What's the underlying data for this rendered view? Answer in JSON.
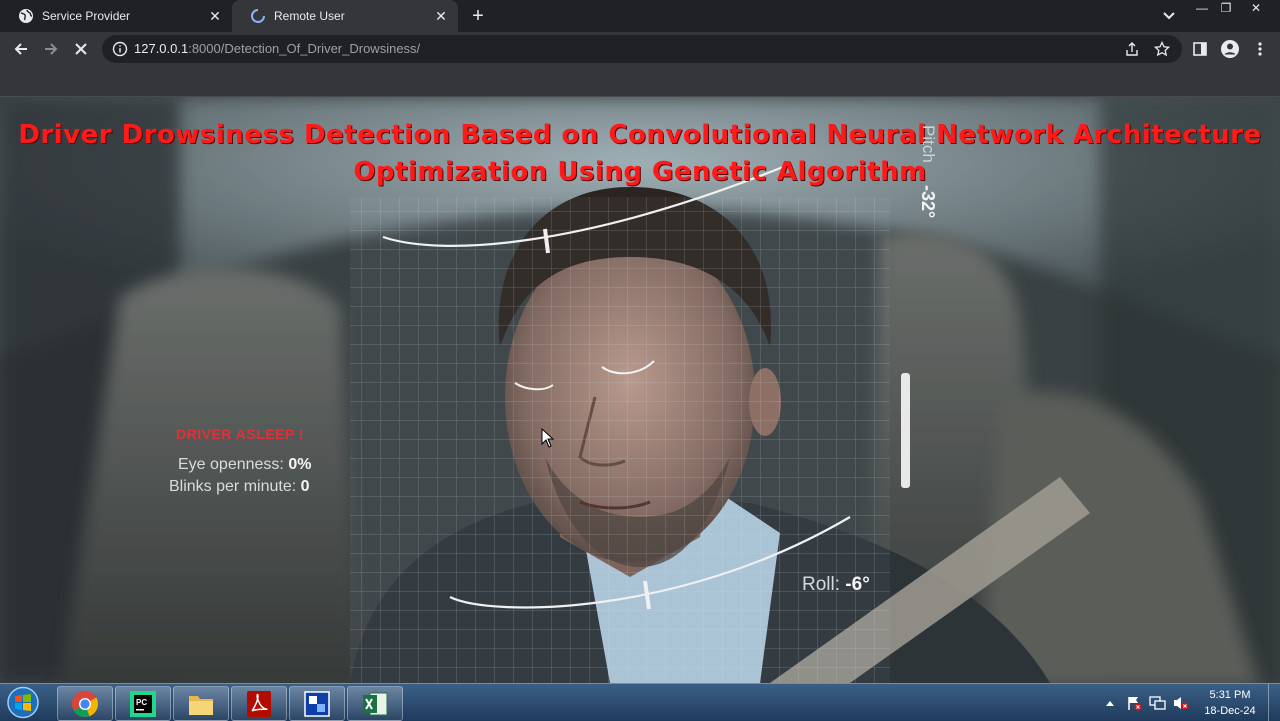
{
  "browser": {
    "tabs": [
      {
        "title": "Service Provider",
        "active": false
      },
      {
        "title": "Remote User",
        "active": true
      }
    ],
    "url_host": "127.0.0.1",
    "url_path": ":8000/Detection_Of_Driver_Drowsiness/"
  },
  "page": {
    "heading_line1": "Driver Drowsiness Detection Based on Convolutional Neural Network Architecture",
    "heading_line2": "Optimization Using Genetic Algorithm",
    "heading_color": "#ff1a1a",
    "hud": {
      "status": "DRIVER ASLEEP !",
      "eye_label": "Eye openness:",
      "eye_value": "0%",
      "blink_label": "Blinks per minute:",
      "blink_value": "0",
      "pitch_label": "Pitch",
      "pitch_value": "-32°",
      "roll_label": "Roll:",
      "roll_value": "-6°"
    }
  },
  "taskbar": {
    "apps": [
      "chrome-icon",
      "pycharm-icon",
      "file-explorer-icon",
      "adobe-reader-icon",
      "remote-app-icon",
      "excel-icon"
    ],
    "clock_time": "5:31 PM",
    "clock_date": "18-Dec-24"
  }
}
